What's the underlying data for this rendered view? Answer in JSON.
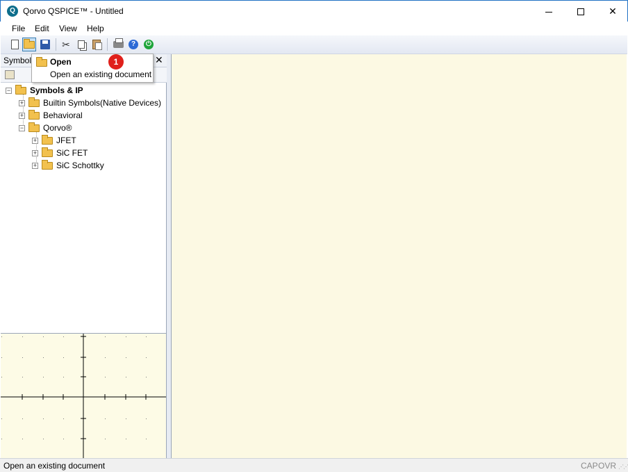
{
  "window": {
    "title": "Qorvo QSPICE™ - Untitled",
    "app_icon_letter": "Q"
  },
  "menu": {
    "items": [
      "File",
      "Edit",
      "View",
      "Help"
    ]
  },
  "toolbar": {
    "buttons": [
      {
        "name": "new-icon"
      },
      {
        "name": "open-icon",
        "pressed": true
      },
      {
        "name": "save-icon"
      },
      {
        "name": "cut-icon"
      },
      {
        "name": "copy-icon"
      },
      {
        "name": "paste-icon"
      },
      {
        "name": "print-icon"
      },
      {
        "name": "help-icon"
      },
      {
        "name": "power-icon"
      }
    ]
  },
  "tooltip": {
    "title": "Open",
    "description": "Open an existing document",
    "step_number": "1",
    "step_color": "#e0201b"
  },
  "panel": {
    "title": "Symbol",
    "close_glyph": "✕"
  },
  "tree": {
    "root": "Symbols & IP",
    "children": [
      {
        "label": "Builtin Symbols(Native Devices)",
        "expanded": false
      },
      {
        "label": "Behavioral",
        "expanded": false
      },
      {
        "label": "Qorvo®",
        "expanded": true,
        "children": [
          "JFET",
          "SiC FET",
          "SiC Schottky"
        ]
      }
    ]
  },
  "status": {
    "message": "Open an existing document",
    "cap": "CAP",
    "ovr": "OVR"
  },
  "colors": {
    "canvas_bg": "#fcf9e3",
    "accent": "#1f70c4"
  }
}
